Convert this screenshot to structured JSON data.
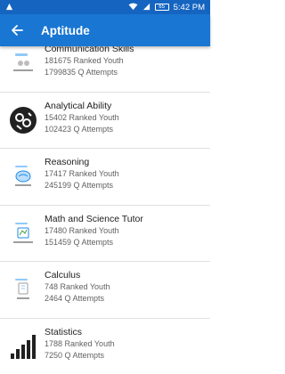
{
  "status_bar": {
    "battery": "65",
    "time": "5:42 PM",
    "icons": [
      "notification-icon",
      "wifi-icon",
      "signal-icon",
      "battery-icon"
    ]
  },
  "app_bar": {
    "title": "Aptitude",
    "back_icon": "arrow-back-icon"
  },
  "colors": {
    "status_bar": "#1565c0",
    "app_bar": "#1976d2"
  },
  "items": [
    {
      "title": "Communication Skills",
      "ranked": "181675 Ranked Youth",
      "attempts": "1799835 Q Attempts",
      "icon": "communication-skills-icon"
    },
    {
      "title": "Analytical Ability",
      "ranked": "15402 Ranked Youth",
      "attempts": "102423 Q Attempts",
      "icon": "analytical-ability-icon"
    },
    {
      "title": "Reasoning",
      "ranked": "17417 Ranked Youth",
      "attempts": "245199 Q Attempts",
      "icon": "reasoning-brain-icon"
    },
    {
      "title": "Math and Science Tutor",
      "ranked": "17480 Ranked Youth",
      "attempts": "151459 Q Attempts",
      "icon": "math-science-icon"
    },
    {
      "title": "Calculus",
      "ranked": "748 Ranked Youth",
      "attempts": "2464 Q Attempts",
      "icon": "calculus-icon"
    },
    {
      "title": "Statistics",
      "ranked": "1788 Ranked Youth",
      "attempts": "7250 Q Attempts",
      "icon": "statistics-bar-chart-icon"
    }
  ]
}
